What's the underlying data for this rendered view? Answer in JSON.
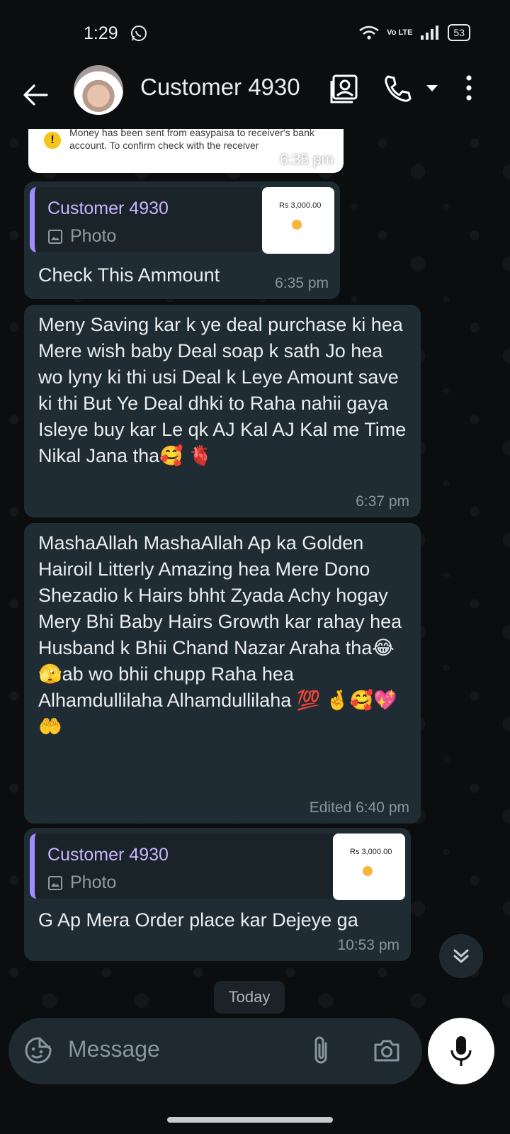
{
  "status_bar": {
    "time": "1:29",
    "network": "Vo LTE",
    "battery": "53"
  },
  "app_bar": {
    "contact_name": "Customer 4930"
  },
  "messages": [
    {
      "note": "Money has been sent from easypaisa to receiver's bank account. To confirm check with the receiver",
      "time": "6:35 pm"
    },
    {
      "quote_name": "Customer 4930",
      "quote_type": "Photo",
      "thumb_amount": "Rs 3,000.00",
      "text": "Check This Ammount",
      "time": "6:35 pm"
    },
    {
      "text": "Meny Saving kar k ye deal purchase ki hea Mere wish baby Deal soap k sath Jo hea wo lyny ki thi usi Deal k Leye Amount save ki thi But Ye Deal dhki to Raha nahii gaya Isleye buy kar Le qk AJ Kal AJ Kal me Time Nikal Jana tha🥰 🫀",
      "time": "6:37 pm"
    },
    {
      "text": "MashaAllah MashaAllah Ap ka Golden Hairoil Litterly Amazing hea Mere Dono Shezadio k Hairs bhht Zyada Achy hogay Mery Bhi Baby Hairs Growth kar rahay hea Husband k Bhii Chand Nazar Araha tha😂 🫣ab wo bhii chupp Raha hea Alhamdullilaha Alhamdullilaha 💯 🤞🥰💖🤲",
      "edited": "Edited",
      "time": "6:40 pm"
    },
    {
      "quote_name": "Customer 4930",
      "quote_type": "Photo",
      "thumb_amount": "Rs 3,000.00",
      "text": "G Ap Mera Order place kar Dejeye ga",
      "time": "10:53 pm"
    }
  ],
  "date_separator": "Today",
  "composer": {
    "placeholder": "Message"
  },
  "icons": [
    "back-arrow-icon",
    "contact-card-icon",
    "phone-icon",
    "dropdown-caret-icon",
    "more-options-icon",
    "sticker-icon",
    "attach-icon",
    "camera-icon",
    "mic-icon",
    "scroll-down-icon",
    "whatsapp-icon",
    "wifi-icon",
    "signal-icon"
  ]
}
